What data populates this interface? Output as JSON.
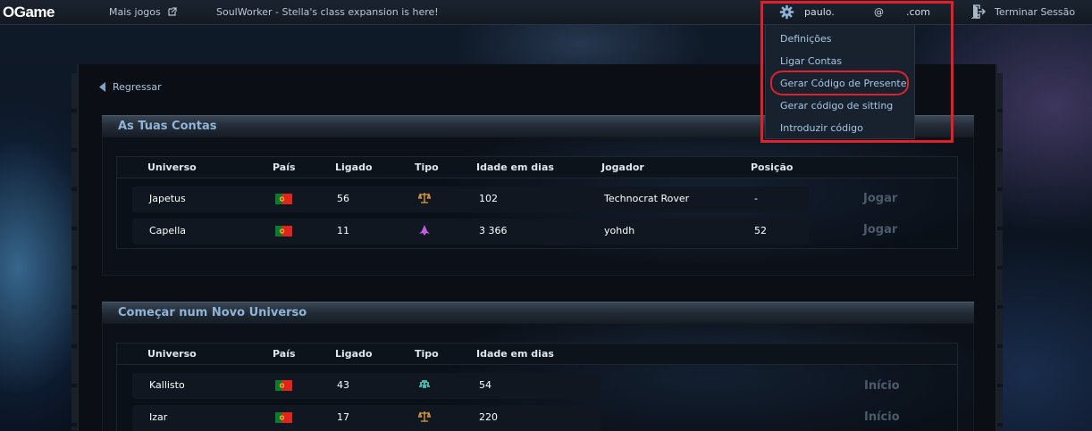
{
  "topbar": {
    "logo": "OGame",
    "more_games": "Mais jogos",
    "news": "SoulWorker - Stella's class expansion is here!",
    "user_name": "paulo.",
    "user_at": "@",
    "user_domain": ".com",
    "logout": "Terminar Sessão"
  },
  "dropdown": {
    "items": [
      {
        "label": "Definições"
      },
      {
        "label": "Ligar Contas"
      },
      {
        "label": "Gerar Código de Presente"
      },
      {
        "label": "Gerar código de sitting"
      },
      {
        "label": "Introduzir código"
      }
    ]
  },
  "back": {
    "label": "Regressar"
  },
  "accounts": {
    "title": "As Tuas Contas",
    "headers": [
      "Universo",
      "País",
      "Ligado",
      "Tipo",
      "Idade em dias",
      "Jogador",
      "Posição"
    ],
    "rows": [
      {
        "universe": "Japetus",
        "country": "PT",
        "online": "56",
        "type": "balance-icon",
        "age": "102",
        "player": "Technocrat Rover",
        "position": "-",
        "action": "Jogar"
      },
      {
        "universe": "Capella",
        "country": "PT",
        "online": "11",
        "type": "ship-icon",
        "age": "3 366",
        "player": "yohdh",
        "position": "52",
        "action": "Jogar"
      }
    ]
  },
  "new_universe": {
    "title": "Começar num Novo Universo",
    "headers": [
      "Universo",
      "País",
      "Ligado",
      "Tipo",
      "Idade em dias"
    ],
    "rows": [
      {
        "universe": "Kallisto",
        "country": "PT",
        "online": "43",
        "type": "invader-icon",
        "age": "54",
        "action": "Início"
      },
      {
        "universe": "Izar",
        "country": "PT",
        "online": "17",
        "type": "balance-icon",
        "age": "220",
        "action": "Início"
      }
    ]
  },
  "colors": {
    "accent_link": "#a9c5e2",
    "section_title": "#8fb4d8",
    "highlight_red": "#e0202a",
    "type_balance": "#e0a040",
    "type_ship": "#c060e0",
    "type_invader": "#3fb8b0"
  }
}
